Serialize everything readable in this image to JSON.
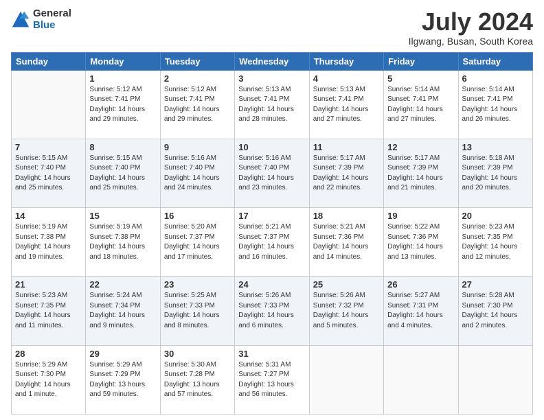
{
  "logo": {
    "general": "General",
    "blue": "Blue"
  },
  "header": {
    "title": "July 2024",
    "subtitle": "Ilgwang, Busan, South Korea"
  },
  "weekdays": [
    "Sunday",
    "Monday",
    "Tuesday",
    "Wednesday",
    "Thursday",
    "Friday",
    "Saturday"
  ],
  "weeks": [
    [
      {
        "day": "",
        "info": ""
      },
      {
        "day": "1",
        "info": "Sunrise: 5:12 AM\nSunset: 7:41 PM\nDaylight: 14 hours\nand 29 minutes."
      },
      {
        "day": "2",
        "info": "Sunrise: 5:12 AM\nSunset: 7:41 PM\nDaylight: 14 hours\nand 29 minutes."
      },
      {
        "day": "3",
        "info": "Sunrise: 5:13 AM\nSunset: 7:41 PM\nDaylight: 14 hours\nand 28 minutes."
      },
      {
        "day": "4",
        "info": "Sunrise: 5:13 AM\nSunset: 7:41 PM\nDaylight: 14 hours\nand 27 minutes."
      },
      {
        "day": "5",
        "info": "Sunrise: 5:14 AM\nSunset: 7:41 PM\nDaylight: 14 hours\nand 27 minutes."
      },
      {
        "day": "6",
        "info": "Sunrise: 5:14 AM\nSunset: 7:41 PM\nDaylight: 14 hours\nand 26 minutes."
      }
    ],
    [
      {
        "day": "7",
        "info": "Sunrise: 5:15 AM\nSunset: 7:40 PM\nDaylight: 14 hours\nand 25 minutes."
      },
      {
        "day": "8",
        "info": "Sunrise: 5:15 AM\nSunset: 7:40 PM\nDaylight: 14 hours\nand 25 minutes."
      },
      {
        "day": "9",
        "info": "Sunrise: 5:16 AM\nSunset: 7:40 PM\nDaylight: 14 hours\nand 24 minutes."
      },
      {
        "day": "10",
        "info": "Sunrise: 5:16 AM\nSunset: 7:40 PM\nDaylight: 14 hours\nand 23 minutes."
      },
      {
        "day": "11",
        "info": "Sunrise: 5:17 AM\nSunset: 7:39 PM\nDaylight: 14 hours\nand 22 minutes."
      },
      {
        "day": "12",
        "info": "Sunrise: 5:17 AM\nSunset: 7:39 PM\nDaylight: 14 hours\nand 21 minutes."
      },
      {
        "day": "13",
        "info": "Sunrise: 5:18 AM\nSunset: 7:39 PM\nDaylight: 14 hours\nand 20 minutes."
      }
    ],
    [
      {
        "day": "14",
        "info": "Sunrise: 5:19 AM\nSunset: 7:38 PM\nDaylight: 14 hours\nand 19 minutes."
      },
      {
        "day": "15",
        "info": "Sunrise: 5:19 AM\nSunset: 7:38 PM\nDaylight: 14 hours\nand 18 minutes."
      },
      {
        "day": "16",
        "info": "Sunrise: 5:20 AM\nSunset: 7:37 PM\nDaylight: 14 hours\nand 17 minutes."
      },
      {
        "day": "17",
        "info": "Sunrise: 5:21 AM\nSunset: 7:37 PM\nDaylight: 14 hours\nand 16 minutes."
      },
      {
        "day": "18",
        "info": "Sunrise: 5:21 AM\nSunset: 7:36 PM\nDaylight: 14 hours\nand 14 minutes."
      },
      {
        "day": "19",
        "info": "Sunrise: 5:22 AM\nSunset: 7:36 PM\nDaylight: 14 hours\nand 13 minutes."
      },
      {
        "day": "20",
        "info": "Sunrise: 5:23 AM\nSunset: 7:35 PM\nDaylight: 14 hours\nand 12 minutes."
      }
    ],
    [
      {
        "day": "21",
        "info": "Sunrise: 5:23 AM\nSunset: 7:35 PM\nDaylight: 14 hours\nand 11 minutes."
      },
      {
        "day": "22",
        "info": "Sunrise: 5:24 AM\nSunset: 7:34 PM\nDaylight: 14 hours\nand 9 minutes."
      },
      {
        "day": "23",
        "info": "Sunrise: 5:25 AM\nSunset: 7:33 PM\nDaylight: 14 hours\nand 8 minutes."
      },
      {
        "day": "24",
        "info": "Sunrise: 5:26 AM\nSunset: 7:33 PM\nDaylight: 14 hours\nand 6 minutes."
      },
      {
        "day": "25",
        "info": "Sunrise: 5:26 AM\nSunset: 7:32 PM\nDaylight: 14 hours\nand 5 minutes."
      },
      {
        "day": "26",
        "info": "Sunrise: 5:27 AM\nSunset: 7:31 PM\nDaylight: 14 hours\nand 4 minutes."
      },
      {
        "day": "27",
        "info": "Sunrise: 5:28 AM\nSunset: 7:30 PM\nDaylight: 14 hours\nand 2 minutes."
      }
    ],
    [
      {
        "day": "28",
        "info": "Sunrise: 5:29 AM\nSunset: 7:30 PM\nDaylight: 14 hours\nand 1 minute."
      },
      {
        "day": "29",
        "info": "Sunrise: 5:29 AM\nSunset: 7:29 PM\nDaylight: 13 hours\nand 59 minutes."
      },
      {
        "day": "30",
        "info": "Sunrise: 5:30 AM\nSunset: 7:28 PM\nDaylight: 13 hours\nand 57 minutes."
      },
      {
        "day": "31",
        "info": "Sunrise: 5:31 AM\nSunset: 7:27 PM\nDaylight: 13 hours\nand 56 minutes."
      },
      {
        "day": "",
        "info": ""
      },
      {
        "day": "",
        "info": ""
      },
      {
        "day": "",
        "info": ""
      }
    ]
  ]
}
